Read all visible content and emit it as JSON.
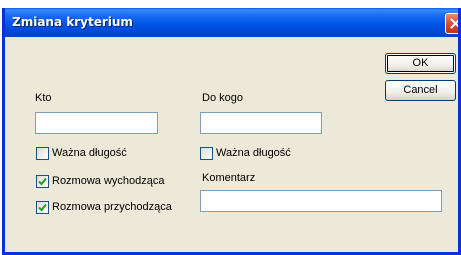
{
  "window": {
    "title": "Zmiana kryterium"
  },
  "form": {
    "kto_label": "Kto",
    "kto_value": "",
    "do_kogo_label": "Do kogo",
    "do_kogo_value": "",
    "wazna_dlugosc_left": {
      "label": "Ważna długość",
      "checked": false
    },
    "wazna_dlugosc_right": {
      "label": "Ważna długość",
      "checked": false
    },
    "rozmowa_wychodzaca": {
      "label": "Rozmowa wychodząca",
      "checked": true
    },
    "rozmowa_przychodzaca": {
      "label": "Rozmowa przychodząca",
      "checked": true
    },
    "komentarz_label": "Komentarz",
    "komentarz_value": ""
  },
  "buttons": {
    "ok": "OK",
    "cancel": "Cancel"
  },
  "icons": {
    "close": "close-icon",
    "checkmark": "checkmark-icon"
  },
  "colors": {
    "title_bar": "#0055e6",
    "window_bg": "#ece9d8",
    "close_button": "#d84830",
    "check_mark": "#21a121"
  }
}
